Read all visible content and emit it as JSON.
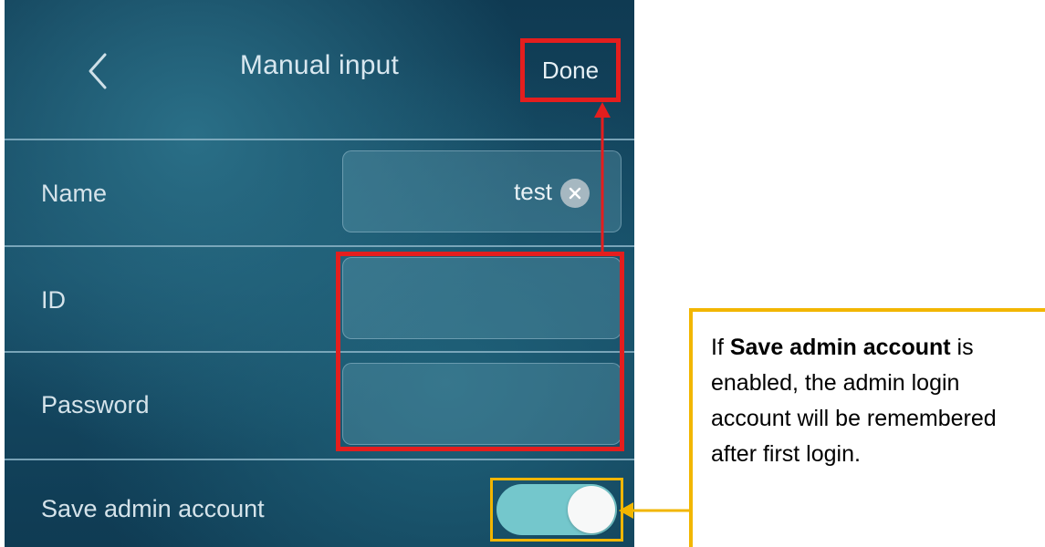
{
  "header": {
    "title": "Manual input",
    "done_label": "Done"
  },
  "fields": {
    "name_label": "Name",
    "name_value": "test",
    "id_label": "ID",
    "password_label": "Password",
    "save_admin_label": "Save admin account",
    "save_admin_enabled": true
  },
  "callout": {
    "prefix": "If ",
    "bold": "Save admin account",
    "suffix": " is enabled, the admin login account will be remembered after first login."
  },
  "colors": {
    "highlight_red": "#e41e1e",
    "highlight_yellow": "#f2b600",
    "toggle_on": "#74c7cc"
  },
  "icons": {
    "back": "chevron-left-icon",
    "clear": "clear-icon"
  }
}
